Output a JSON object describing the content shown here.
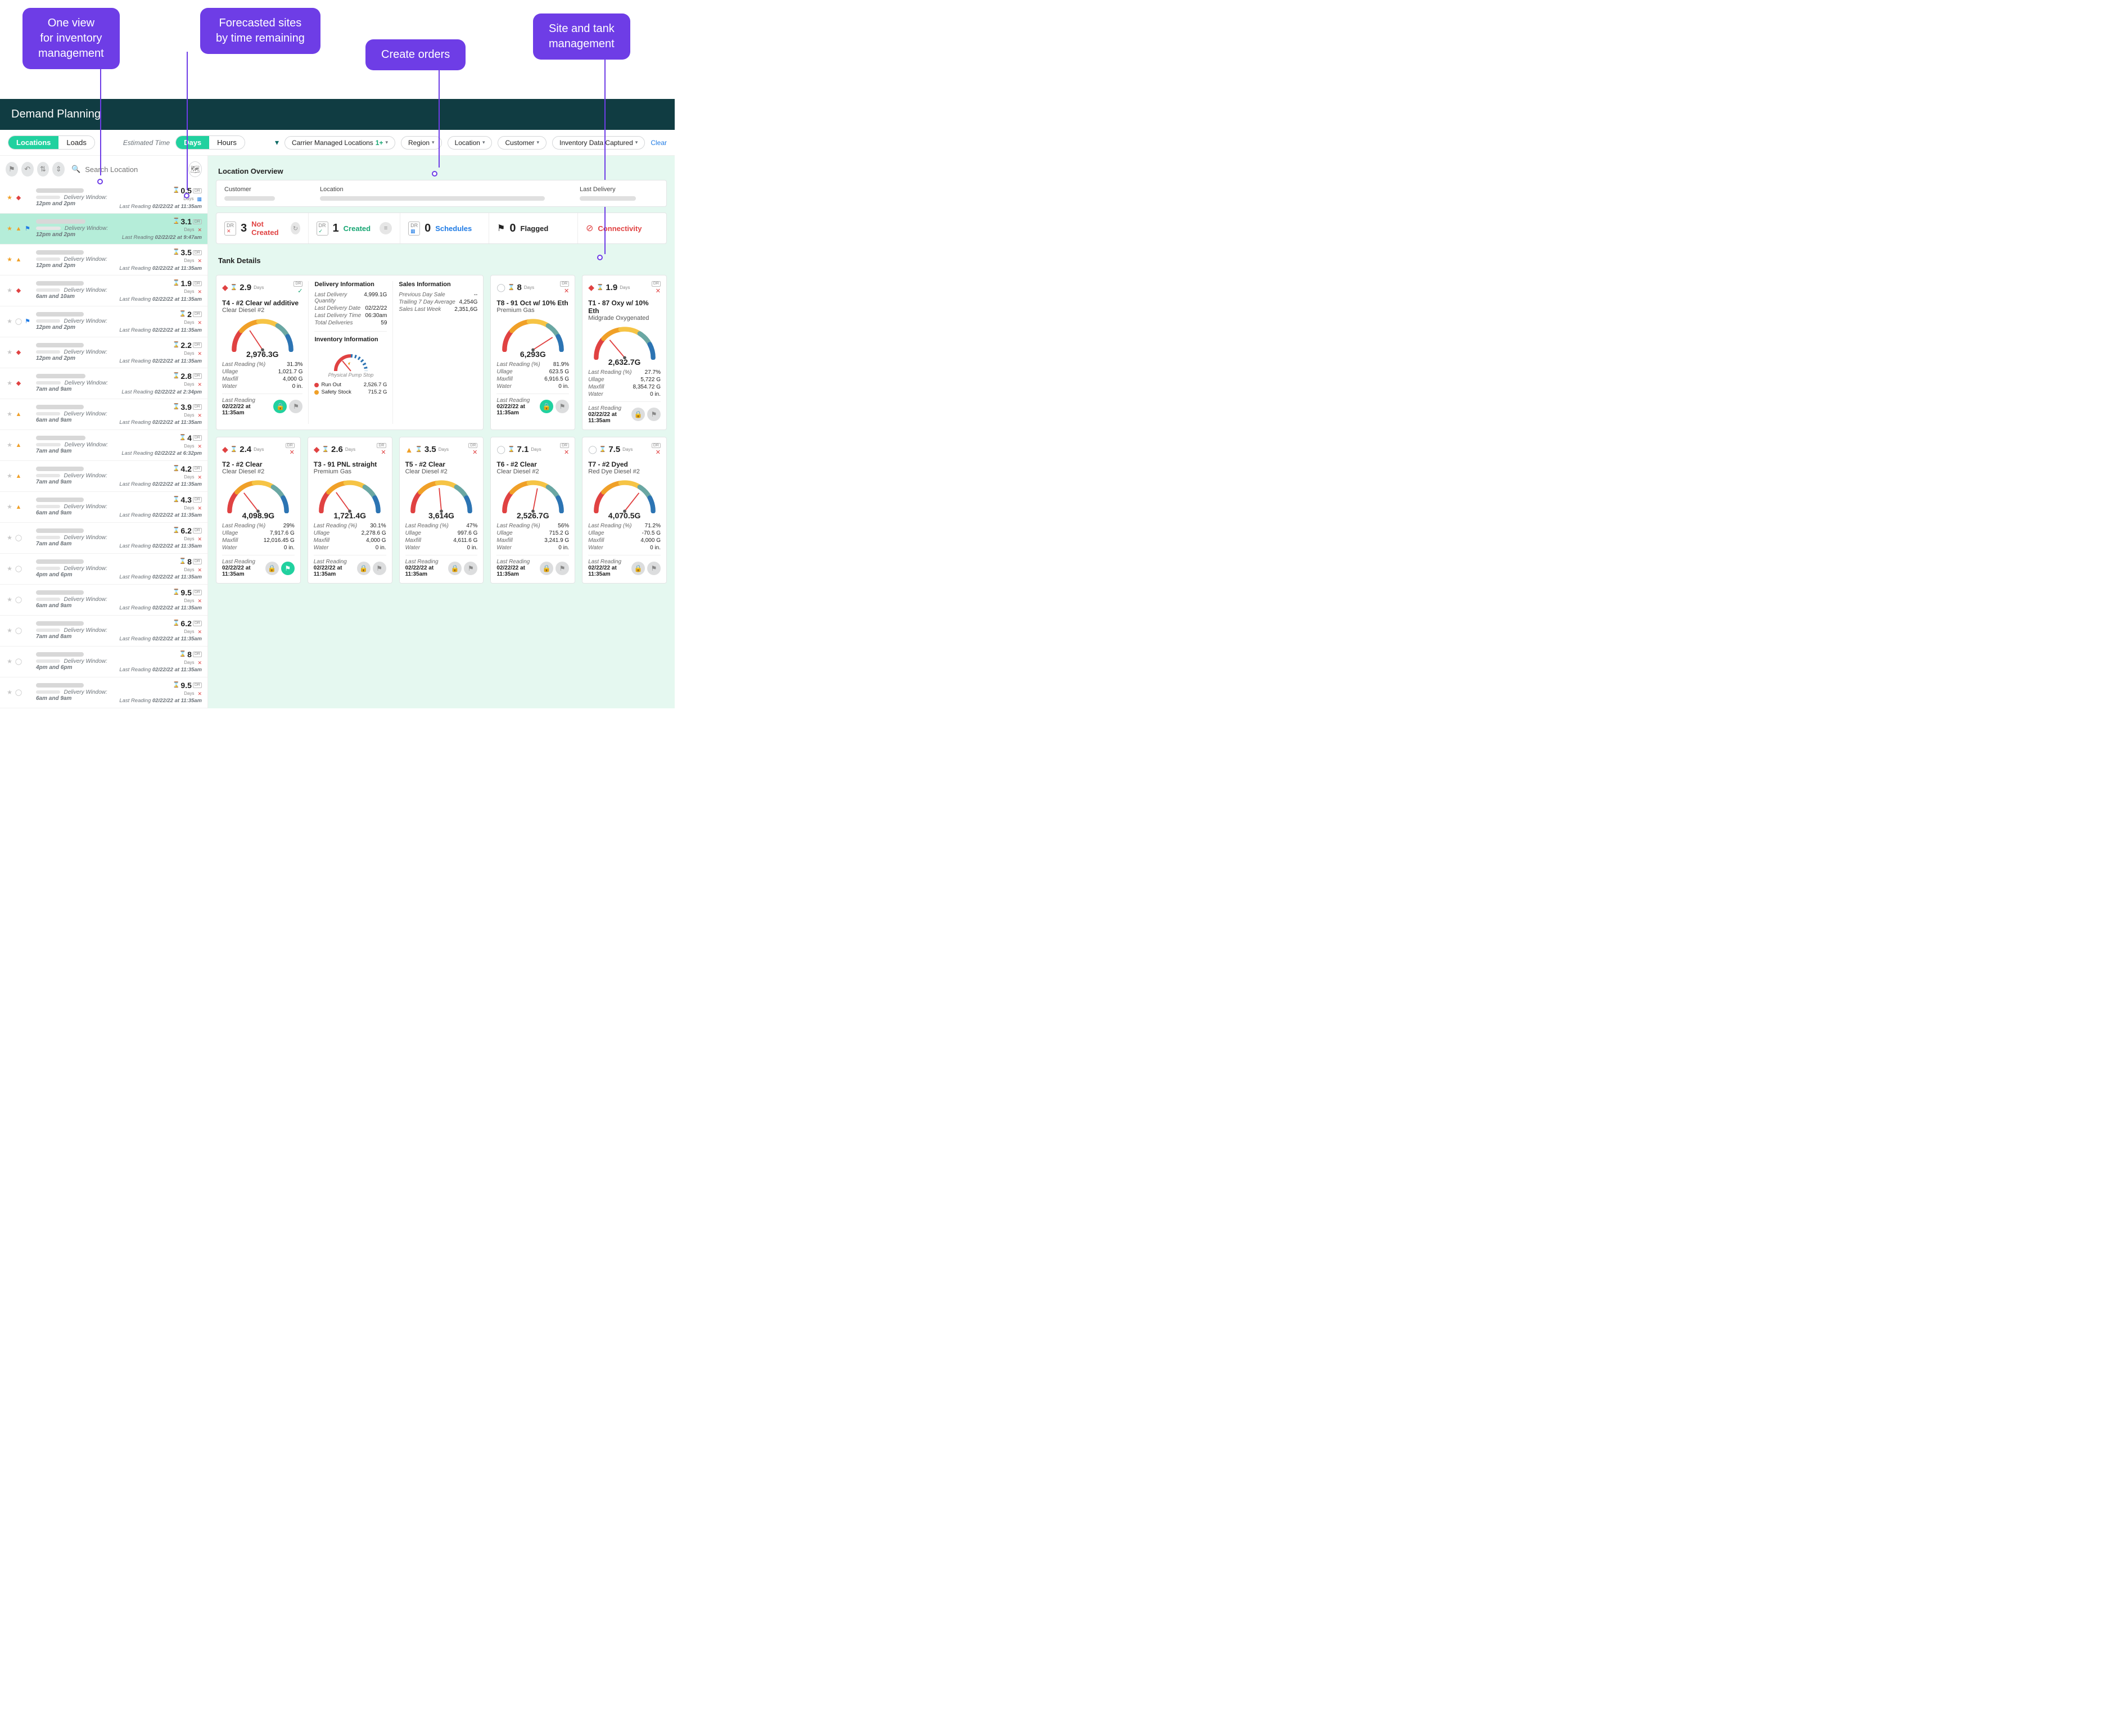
{
  "annotations": {
    "a1": "One view\nfor inventory\nmanagement",
    "a2": "Forecasted sites\nby time remaining",
    "a3": "Create orders",
    "a4": "Site and tank\nmanagement"
  },
  "app": {
    "title": "Demand Planning"
  },
  "topbar": {
    "tabs": {
      "locations": "Locations",
      "loads": "Loads"
    },
    "estimated_label": "Estimated Time",
    "time_tabs": {
      "days": "Days",
      "hours": "Hours"
    },
    "filters": {
      "carrier": {
        "label": "Carrier Managed Locations",
        "badge": "1+"
      },
      "region": "Region",
      "location": "Location",
      "customer": "Customer",
      "inventory": "Inventory Data Captured"
    },
    "clear": "Clear"
  },
  "left": {
    "search_placeholder": "Search Location",
    "delivery_window_label": "Delivery Window:",
    "last_reading_label": "Last Reading",
    "rows": [
      {
        "icons": [
          "star",
          "excl"
        ],
        "window": "12pm and 2pm",
        "days": "0.5",
        "dr_mode": "cal",
        "last": "02/22/22 at 11:35am"
      },
      {
        "icons": [
          "star",
          "warn",
          "flag"
        ],
        "window": "12pm and 2pm",
        "days": "3.1",
        "dr_mode": "x",
        "last": "02/22/22 at 9:47am",
        "selected": true
      },
      {
        "icons": [
          "star",
          "warn"
        ],
        "window": "12pm and 2pm",
        "days": "3.5",
        "dr_mode": "x",
        "last": "02/22/22 at 11:35am"
      },
      {
        "icons": [
          "graystar",
          "excl"
        ],
        "window": "6am and 10am",
        "days": "1.9",
        "dr_mode": "x",
        "last": "02/22/22 at 11:35am"
      },
      {
        "icons": [
          "graystar",
          "circ",
          "flag"
        ],
        "window": "12pm and 2pm",
        "days": "2",
        "dr_mode": "x",
        "last": "02/22/22 at 11:35am"
      },
      {
        "icons": [
          "graystar",
          "excl"
        ],
        "window": "12pm and 2pm",
        "days": "2.2",
        "dr_mode": "x",
        "last": "02/22/22 at 11:35am"
      },
      {
        "icons": [
          "graystar",
          "excl"
        ],
        "window": "7am and 9am",
        "days": "2.8",
        "dr_mode": "x",
        "last": "02/22/22 at 2:34pm"
      },
      {
        "icons": [
          "graystar",
          "warn"
        ],
        "window": "6am and 9am",
        "days": "3.9",
        "dr_mode": "x",
        "last": "02/22/22 at 11:35am"
      },
      {
        "icons": [
          "graystar",
          "warn"
        ],
        "window": "7am and 9am",
        "days": "4",
        "dr_mode": "x",
        "last": "02/22/22 at 6:32pm"
      },
      {
        "icons": [
          "graystar",
          "warn"
        ],
        "window": "7am and 9am",
        "days": "4.2",
        "dr_mode": "x",
        "last": "02/22/22 at 11:35am"
      },
      {
        "icons": [
          "graystar",
          "warn"
        ],
        "window": "6am and 9am",
        "days": "4.3",
        "dr_mode": "x",
        "last": "02/22/22 at 11:35am"
      },
      {
        "icons": [
          "graystar",
          "circ"
        ],
        "window": "7am and 8am",
        "days": "6.2",
        "dr_mode": "x",
        "last": "02/22/22 at 11:35am"
      },
      {
        "icons": [
          "graystar",
          "circ"
        ],
        "window": "4pm and 6pm",
        "days": "8",
        "dr_mode": "x",
        "last": "02/22/22 at 11:35am"
      },
      {
        "icons": [
          "graystar",
          "circ"
        ],
        "window": "6am and 9am",
        "days": "9.5",
        "dr_mode": "x",
        "last": "02/22/22 at 11:35am"
      },
      {
        "icons": [
          "graystar",
          "circ"
        ],
        "window": "7am and 8am",
        "days": "6.2",
        "dr_mode": "x",
        "last": "02/22/22 at 11:35am"
      },
      {
        "icons": [
          "graystar",
          "circ"
        ],
        "window": "4pm and 6pm",
        "days": "8",
        "dr_mode": "x",
        "last": "02/22/22 at 11:35am"
      },
      {
        "icons": [
          "graystar",
          "circ"
        ],
        "window": "6am and 9am",
        "days": "9.5",
        "dr_mode": "x",
        "last": "02/22/22 at 11:35am"
      }
    ]
  },
  "overview": {
    "title": "Location Overview",
    "cols": {
      "customer": "Customer",
      "location": "Location",
      "last_delivery": "Last Delivery"
    }
  },
  "status": {
    "not_created": {
      "count": "3",
      "label": "Not Created"
    },
    "created": {
      "count": "1",
      "label": "Created"
    },
    "schedules": {
      "count": "0",
      "label": "Schedules"
    },
    "flagged": {
      "count": "0",
      "label": "Flagged"
    },
    "connectivity": {
      "label": "Connectivity"
    }
  },
  "tank_section_title": "Tank Details",
  "labels": {
    "days": "Days",
    "last_reading": "Last Reading",
    "last_reading_pct": "Last Reading (%)",
    "ullage": "Ullage",
    "maxfill": "Maxfill",
    "water": "Water",
    "delivery_info": "Delivery Information",
    "sales_info": "Sales Information",
    "inventory_info": "Inventory Information",
    "ldq": "Last Delivery Quantity",
    "ldd": "Last Delivery Date",
    "ldt": "Last Delivery Time",
    "total_deliveries": "Total Deliveries",
    "prev_day": "Previous Day Sale",
    "t7": "Trailing 7 Day Average",
    "slw": "Sales Last Week",
    "pps": "Physical Pump Stop",
    "runout": "Run Out",
    "safety": "Safety Stock"
  },
  "tanks": {
    "t4": {
      "status": "excl",
      "days": "2.9",
      "dr": "check",
      "title": "T4 - #2 Clear w/ additive",
      "sub": "Clear Diesel #2",
      "gauge": "2,976.3G",
      "pct": "31.3%",
      "ullage": "1,021.7 G",
      "maxfill": "4,000 G",
      "water": "0 in.",
      "lr": "02/22/22 at 11:35am",
      "lock": true,
      "flag": false,
      "delivery": {
        "qty": "4,999.1G",
        "date": "02/22/22",
        "time": "06:30am",
        "total": "59"
      },
      "sales": {
        "prev": "--",
        "t7": "4,254G",
        "slw": "2,351,6G"
      },
      "inventory": {
        "pps": "",
        "runout": "2,526.7 G",
        "safety": "715.2 G"
      }
    },
    "t8": {
      "status": "circ",
      "days": "8",
      "dr": "x",
      "title": "T8 - 91 Oct w/ 10% Eth",
      "sub": "Premium Gas",
      "gauge": "6,293G",
      "pct": "81.9%",
      "ullage": "623.5 G",
      "maxfill": "6,916.5 G",
      "water": "0 in.",
      "lr": "02/22/22 at 11:35am",
      "lock": true,
      "flag": false
    },
    "t1": {
      "status": "excl",
      "days": "1.9",
      "dr": "x",
      "title": "T1 - 87 Oxy w/ 10% Eth",
      "sub": "Midgrade Oxygenated",
      "gauge": "2,632.7G",
      "pct": "27.7%",
      "ullage": "5,722 G",
      "maxfill": "8,354.72 G",
      "water": "0 in.",
      "lr": "02/22/22 at 11:35am",
      "lock": false,
      "flag": false
    },
    "t2": {
      "status": "excl",
      "days": "2.4",
      "dr": "x",
      "title": "T2 - #2 Clear",
      "sub": "Clear Diesel #2",
      "gauge": "4,098.9G",
      "pct": "29%",
      "ullage": "7,917.6 G",
      "maxfill": "12,016.45 G",
      "water": "0 in.",
      "lr": "02/22/22 at 11:35am",
      "lock": false,
      "flag": true
    },
    "t3": {
      "status": "excl",
      "days": "2.6",
      "dr": "x",
      "title": "T3 - 91 PNL straight",
      "sub": "Premium Gas",
      "gauge": "1,721.4G",
      "pct": "30.1%",
      "ullage": "2,278.6 G",
      "maxfill": "4,000 G",
      "water": "0 in.",
      "lr": "02/22/22 at 11:35am",
      "lock": false,
      "flag": false
    },
    "t5": {
      "status": "warn",
      "days": "3.5",
      "dr": "x",
      "title": "T5 - #2 Clear",
      "sub": "Clear Diesel #2",
      "gauge": "3,614G",
      "pct": "47%",
      "ullage": "997.6 G",
      "maxfill": "4,611.6 G",
      "water": "0 in.",
      "lr": "02/22/22 at 11:35am",
      "lock": false,
      "flag": false
    },
    "t6": {
      "status": "circ",
      "days": "7.1",
      "dr": "x",
      "title": "T6 - #2 Clear",
      "sub": "Clear Diesel #2",
      "gauge": "2,526.7G",
      "pct": "56%",
      "ullage": "715.2 G",
      "maxfill": "3,241.9 G",
      "water": "0 in.",
      "lr": "02/22/22 at 11:35am",
      "lock": false,
      "flag": false
    },
    "t7": {
      "status": "circ",
      "days": "7.5",
      "dr": "x",
      "title": "T7 - #2 Dyed",
      "sub": "Red Dye Diesel #2",
      "gauge": "4,070.5G",
      "pct": "71.2%",
      "ullage": "-70.5 G",
      "maxfill": "4,000 G",
      "water": "0 in.",
      "lr": "02/22/22 at 11:35am",
      "lock": false,
      "flag": false
    }
  },
  "chart_data": [
    {
      "type": "gauge",
      "tank": "T4",
      "value_label": "2,976.3G",
      "percent": 31.3,
      "range": [
        0,
        100
      ],
      "title": "T4 - #2 Clear w/ additive"
    },
    {
      "type": "gauge",
      "tank": "T8",
      "value_label": "6,293G",
      "percent": 81.9,
      "range": [
        0,
        100
      ],
      "title": "T8 - 91 Oct w/ 10% Eth"
    },
    {
      "type": "gauge",
      "tank": "T1",
      "value_label": "2,632.7G",
      "percent": 27.7,
      "range": [
        0,
        100
      ],
      "title": "T1 - 87 Oxy w/ 10% Eth"
    },
    {
      "type": "gauge",
      "tank": "T2",
      "value_label": "4,098.9G",
      "percent": 29.0,
      "range": [
        0,
        100
      ],
      "title": "T2 - #2 Clear"
    },
    {
      "type": "gauge",
      "tank": "T3",
      "value_label": "1,721.4G",
      "percent": 30.1,
      "range": [
        0,
        100
      ],
      "title": "T3 - 91 PNL straight"
    },
    {
      "type": "gauge",
      "tank": "T5",
      "value_label": "3,614G",
      "percent": 47.0,
      "range": [
        0,
        100
      ],
      "title": "T5 - #2 Clear"
    },
    {
      "type": "gauge",
      "tank": "T6",
      "value_label": "2,526.7G",
      "percent": 56.0,
      "range": [
        0,
        100
      ],
      "title": "T6 - #2 Clear"
    },
    {
      "type": "gauge",
      "tank": "T7",
      "value_label": "4,070.5G",
      "percent": 71.2,
      "range": [
        0,
        100
      ],
      "title": "T7 - #2 Dyed"
    }
  ]
}
